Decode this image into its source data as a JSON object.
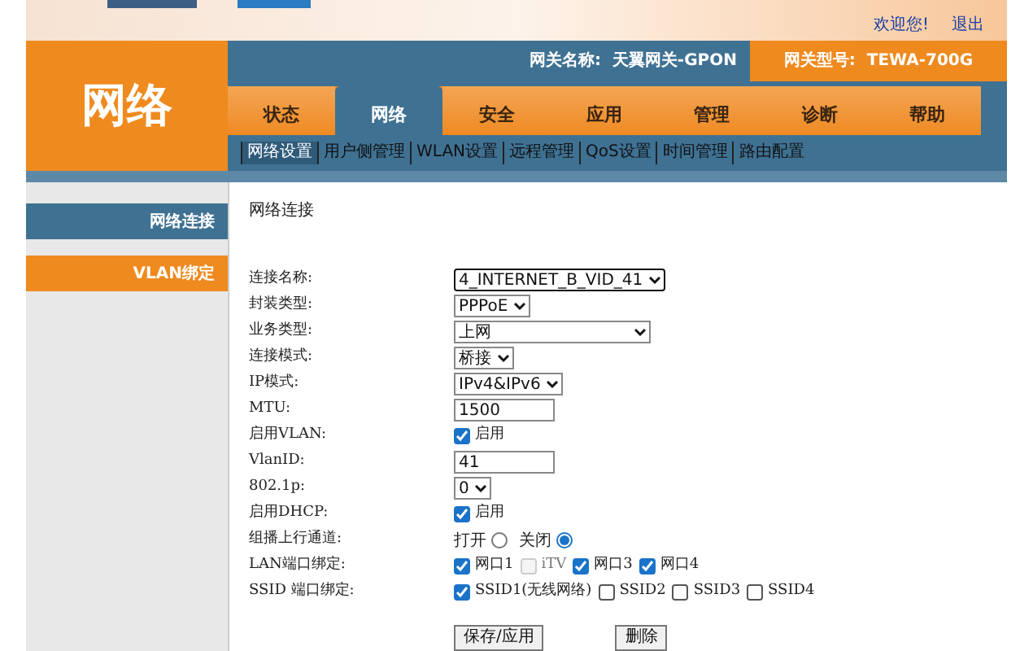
{
  "header": {
    "welcome": "欢迎您!",
    "logout": "退出",
    "section_title": "网络",
    "gateway_name": "网关名称:  天翼网关-GPON",
    "gateway_model": "网关型号:  TEWA-700G"
  },
  "tabs": [
    {
      "label": "状态",
      "selected": false
    },
    {
      "label": "网络",
      "selected": true
    },
    {
      "label": "安全",
      "selected": false
    },
    {
      "label": "应用",
      "selected": false
    },
    {
      "label": "管理",
      "selected": false
    },
    {
      "label": "诊断",
      "selected": false
    },
    {
      "label": "帮助",
      "selected": false
    }
  ],
  "subnav": [
    {
      "label": "网络设置",
      "selected": true
    },
    {
      "label": "用户侧管理",
      "selected": false
    },
    {
      "label": "WLAN设置",
      "selected": false
    },
    {
      "label": "远程管理",
      "selected": false
    },
    {
      "label": "QoS设置",
      "selected": false
    },
    {
      "label": "时间管理",
      "selected": false
    },
    {
      "label": "路由配置",
      "selected": false
    }
  ],
  "sidebar": [
    {
      "label": "网络连接",
      "selected": true
    },
    {
      "label": "VLAN绑定",
      "selected": false
    }
  ],
  "panel_title": "网络连接",
  "form": [
    {
      "kind": "select",
      "label": "连接名称:",
      "value": "4_INTERNET_B_VID_41",
      "focused": true
    },
    {
      "kind": "select",
      "label": "封装类型:",
      "value": "PPPoE"
    },
    {
      "kind": "select",
      "label": "业务类型:",
      "value": "上网",
      "wide": true
    },
    {
      "kind": "select",
      "label": "连接模式:",
      "value": "桥接"
    },
    {
      "kind": "select",
      "label": "IP模式:",
      "value": "IPv4&IPv6"
    },
    {
      "kind": "text",
      "label": "MTU:",
      "value": "1500"
    },
    {
      "kind": "checks",
      "label": "启用VLAN:",
      "options": [
        {
          "label": "启用",
          "checked": true,
          "disabled": false
        }
      ]
    },
    {
      "kind": "text",
      "label": "VlanID:",
      "value": "41"
    },
    {
      "kind": "select",
      "label": "802.1p:",
      "value": "0"
    },
    {
      "kind": "checks",
      "label": "启用DHCP:",
      "options": [
        {
          "label": "启用",
          "checked": true,
          "disabled": false
        }
      ]
    },
    {
      "kind": "radios",
      "label": "组播上行通道:",
      "options": [
        {
          "label": "打开",
          "selected": false
        },
        {
          "label": "关闭",
          "selected": true
        }
      ]
    },
    {
      "kind": "checks",
      "label": "LAN端口绑定:",
      "options": [
        {
          "label": "网口1",
          "checked": true,
          "disabled": false
        },
        {
          "label": "iTV",
          "checked": false,
          "disabled": true
        },
        {
          "label": "网口3",
          "checked": true,
          "disabled": false
        },
        {
          "label": "网口4",
          "checked": true,
          "disabled": false
        }
      ]
    },
    {
      "kind": "checks",
      "label": "SSID 端口绑定:",
      "options": [
        {
          "label": "SSID1(无线网络)",
          "checked": true,
          "disabled": false
        },
        {
          "label": "SSID2",
          "checked": false,
          "disabled": false
        },
        {
          "label": "SSID3",
          "checked": false,
          "disabled": false
        },
        {
          "label": "SSID4",
          "checked": false,
          "disabled": false
        }
      ]
    }
  ],
  "buttons": [
    {
      "label": "保存/应用"
    },
    {
      "label": "删除"
    }
  ]
}
